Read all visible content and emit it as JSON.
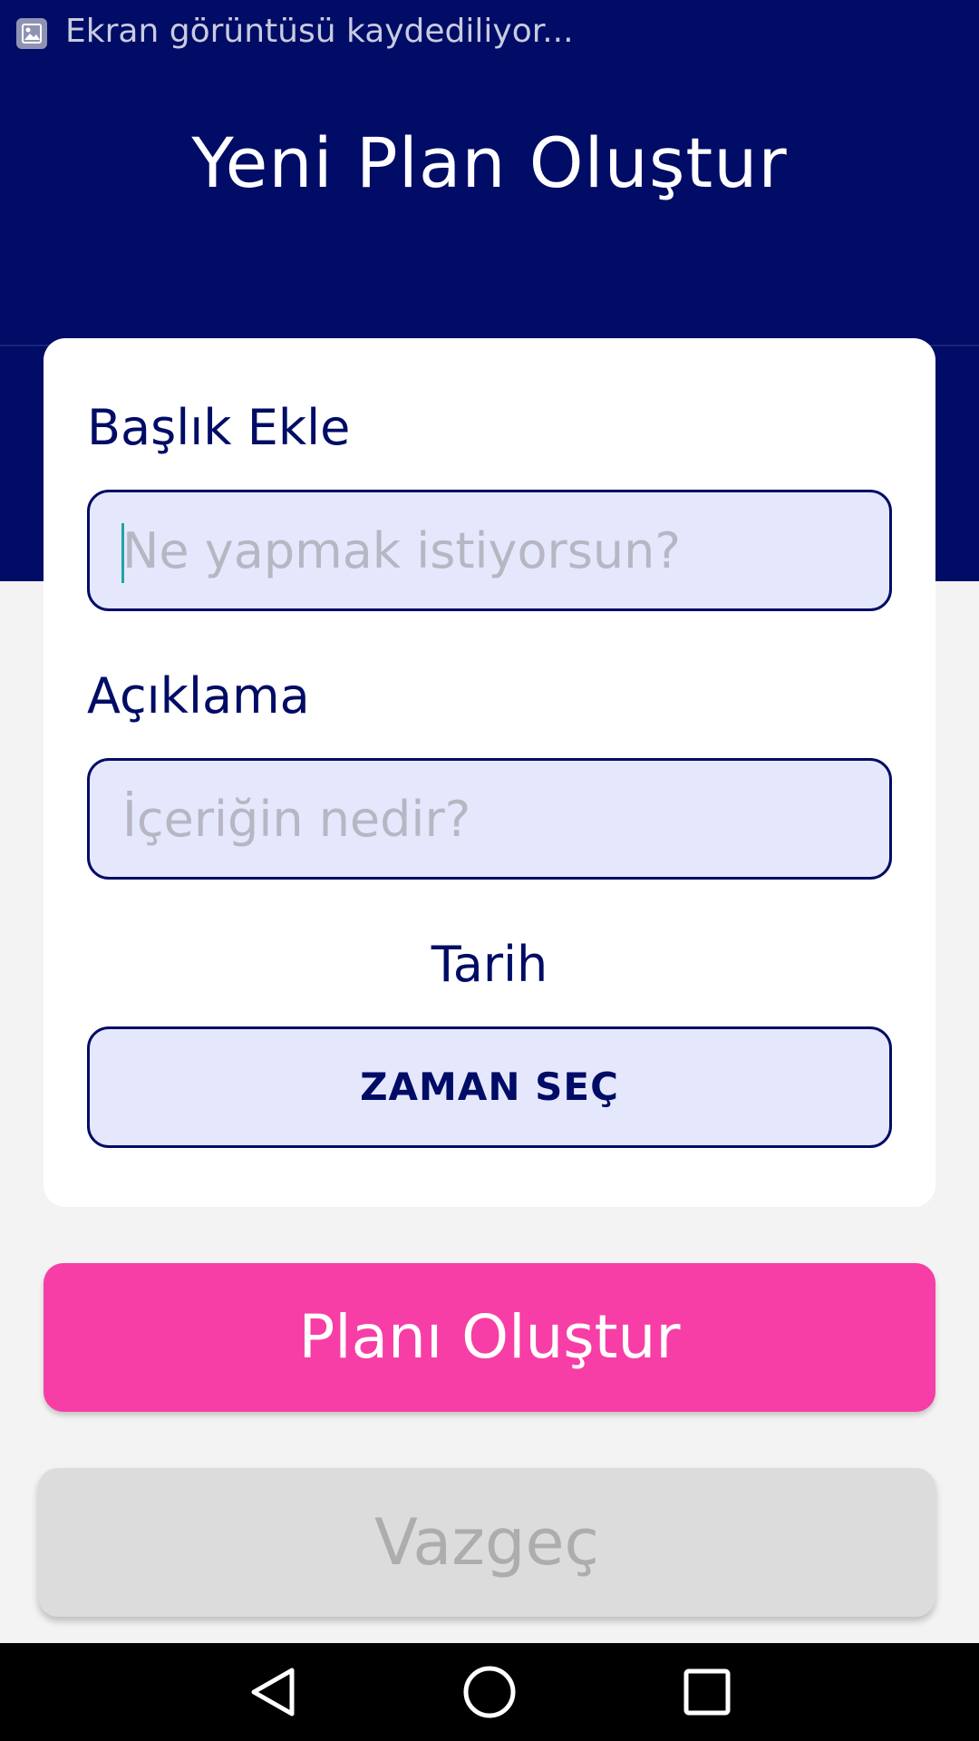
{
  "status_bar": {
    "notification_icon": "image-icon",
    "text": "Ekran görüntüsü kaydediliyor..."
  },
  "header": {
    "title": "Yeni Plan Oluştur"
  },
  "form": {
    "title_label": "Başlık Ekle",
    "title_placeholder": "Ne yapmak istiyorsun?",
    "title_value": "",
    "description_label": "Açıklama",
    "description_placeholder": "İçeriğin nedir?",
    "description_value": "",
    "date_label": "Tarih",
    "time_button_label": "ZAMAN SEÇ"
  },
  "actions": {
    "create_label": "Planı Oluştur",
    "cancel_label": "Vazgeç"
  },
  "nav_bar": {
    "back_icon": "back-triangle-icon",
    "home_icon": "home-circle-icon",
    "recent_icon": "recent-square-icon"
  },
  "colors": {
    "header_background": "#000c66",
    "accent_pink": "#f73ea6",
    "input_background": "#e5e8fd",
    "page_background": "#f3f3f3"
  }
}
